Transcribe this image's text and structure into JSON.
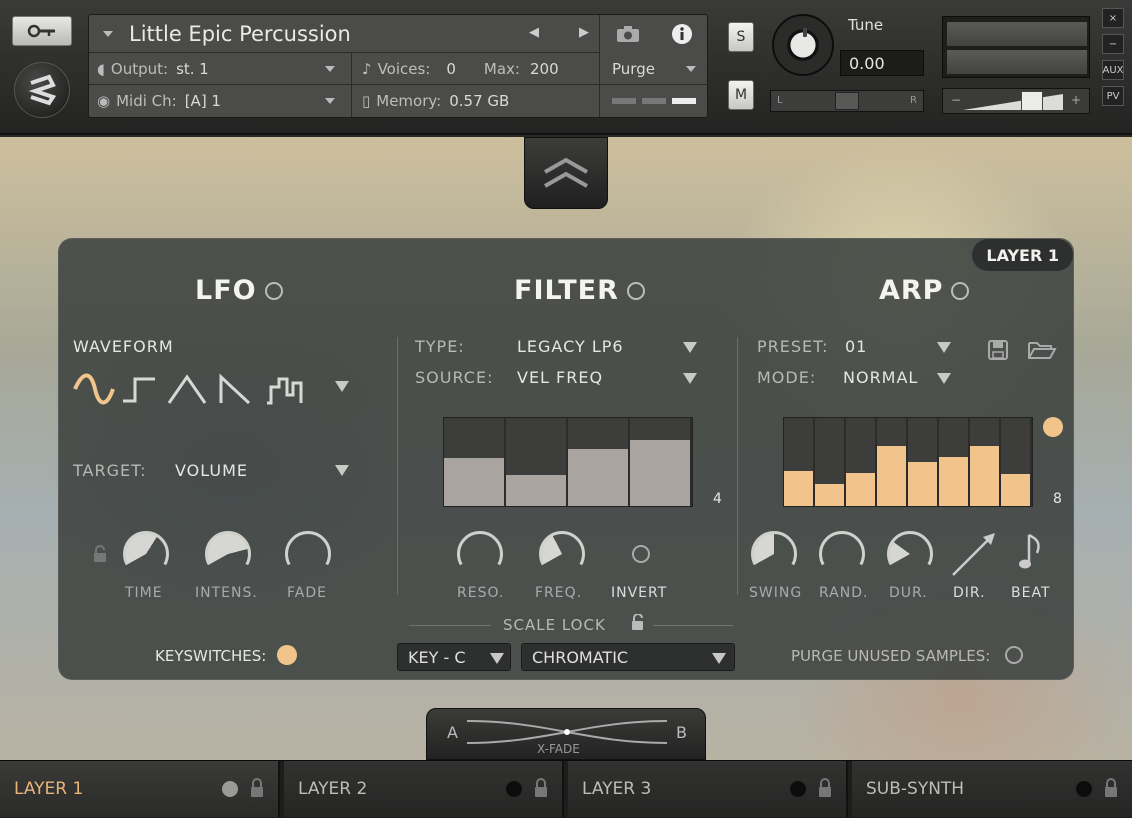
{
  "header": {
    "instrument_title": "Little Epic Percussion",
    "output_label": "Output:",
    "output_value": "st. 1",
    "voices_label": "Voices:",
    "voices_value": "0",
    "max_label": "Max:",
    "max_value": "200",
    "purge_label": "Purge",
    "midi_label": "Midi Ch:",
    "midi_value": "[A] 1",
    "memory_label": "Memory:",
    "memory_value": "0.57 GB",
    "solo_label": "S",
    "mute_label": "M",
    "tune_label": "Tune",
    "tune_value": "0.00",
    "pan_left": "L",
    "pan_right": "R",
    "vol_minus": "−",
    "vol_plus": "+",
    "side_buttons": [
      "×",
      "−",
      "AUX",
      "PV"
    ]
  },
  "layer_badge": "LAYER 1",
  "lfo": {
    "title": "LFO",
    "waveform_label": "WAVEFORM",
    "target_label": "TARGET:",
    "target_value": "VOLUME",
    "knobs": [
      {
        "label": "TIME",
        "value": 0.62
      },
      {
        "label": "INTENS.",
        "value": 0.78
      },
      {
        "label": "FADE",
        "value": 0.0
      }
    ],
    "keyswitches_label": "KEYSWITCHES:"
  },
  "filter": {
    "title": "FILTER",
    "type_label": "TYPE:",
    "type_value": "LEGACY LP6",
    "source_label": "SOURCE:",
    "source_value": "VEL FREQ",
    "steps": [
      0.55,
      0.35,
      0.65,
      0.75
    ],
    "step_count": "4",
    "knobs": [
      {
        "label": "RESO.",
        "value": 0.0
      },
      {
        "label": "FREQ.",
        "value": 0.4
      }
    ],
    "invert_label": "INVERT",
    "scale_lock_label": "SCALE LOCK",
    "key_value": "KEY - C",
    "scale_value": "CHROMATIC"
  },
  "arp": {
    "title": "ARP",
    "preset_label": "PRESET:",
    "preset_value": "01",
    "mode_label": "MODE:",
    "mode_value": "NORMAL",
    "steps": [
      0.4,
      0.25,
      0.38,
      0.68,
      0.5,
      0.56,
      0.68,
      0.36
    ],
    "step_count": "8",
    "knobs": [
      {
        "label": "SWING",
        "value": 0.5
      },
      {
        "label": "RAND.",
        "value": 0.0
      },
      {
        "label": "DUR.",
        "value": 0.3
      }
    ],
    "dir_label": "DIR.",
    "beat_label": "BEAT",
    "purge_unused_label": "PURGE UNUSED SAMPLES:"
  },
  "xfade": {
    "label": "X-FADE",
    "a": "A",
    "b": "B"
  },
  "tabs": [
    {
      "label": "LAYER 1",
      "active": true
    },
    {
      "label": "LAYER 2",
      "active": false
    },
    {
      "label": "LAYER 3",
      "active": false
    },
    {
      "label": "SUB-SYNTH",
      "active": false
    }
  ],
  "colors": {
    "accent": "#f0c48a",
    "step_fill": "#a9a4a0"
  }
}
